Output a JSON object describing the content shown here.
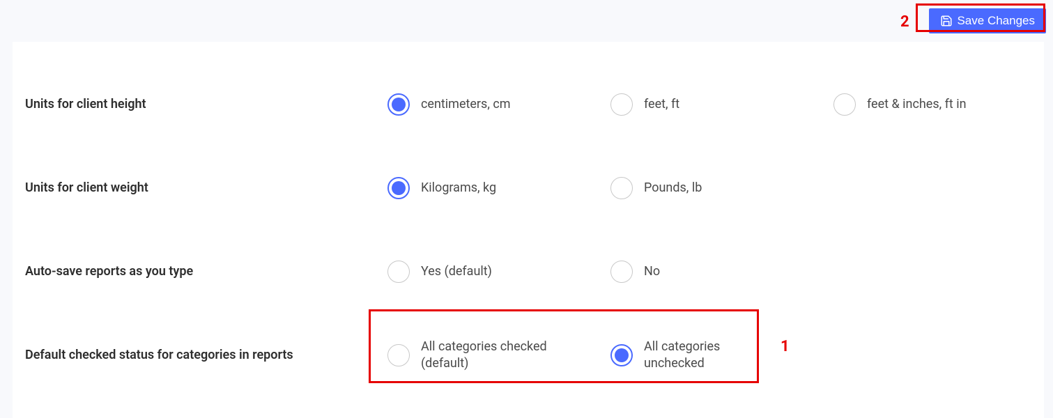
{
  "header": {
    "save_label": "Save Changes"
  },
  "settings": {
    "height": {
      "label": "Units for client height",
      "options": {
        "cm": "centimeters, cm",
        "ft": "feet, ft",
        "ftin": "feet & inches, ft in"
      },
      "selected": "cm"
    },
    "weight": {
      "label": "Units for client weight",
      "options": {
        "kg": "Kilograms, kg",
        "lb": "Pounds, lb"
      },
      "selected": "kg"
    },
    "autosave": {
      "label": "Auto-save reports as you type",
      "options": {
        "yes": "Yes (default)",
        "no": "No"
      },
      "selected": null
    },
    "default_checked": {
      "label": "Default checked status for categories in reports",
      "options": {
        "checked": "All categories checked (default)",
        "unchecked": "All categories unchecked"
      },
      "selected": "unchecked"
    }
  },
  "annotations": {
    "one": "1",
    "two": "2"
  }
}
